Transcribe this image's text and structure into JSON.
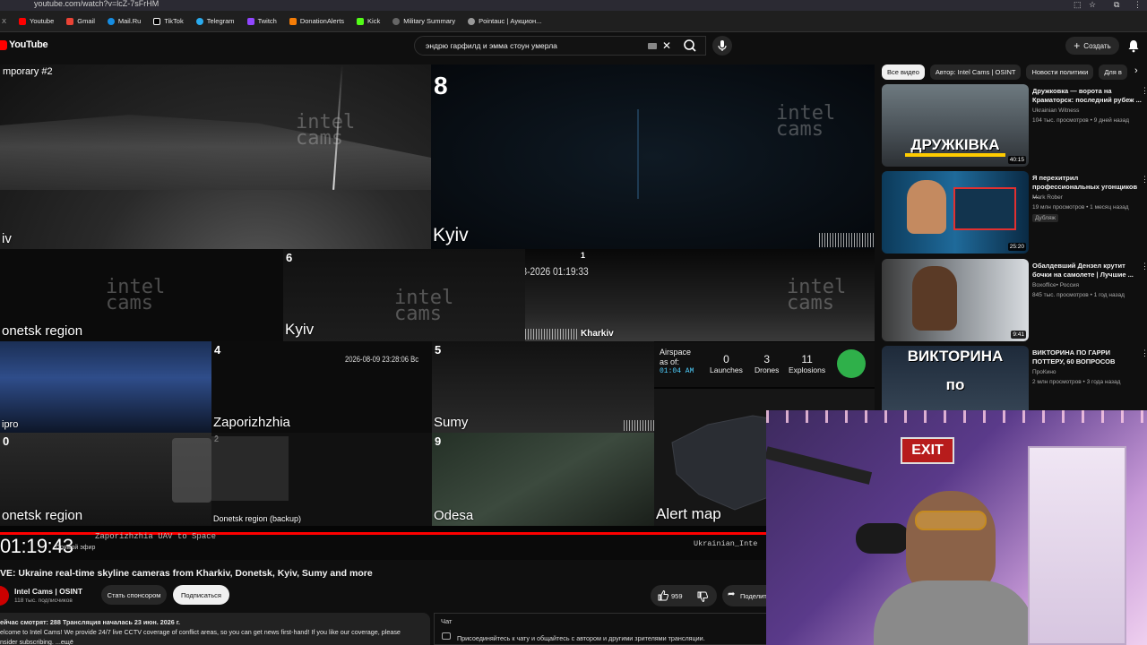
{
  "browser": {
    "url": "youtube.com/watch?v=lcZ-7sFrHM",
    "bookmarks": [
      "Youtube",
      "Gmail",
      "Mail.Ru",
      "TikTok",
      "Telegram",
      "Twitch",
      "DonationAlerts",
      "Kick",
      "Military Summary",
      "Pointauc | Аукцион..."
    ],
    "bookmark_colors": [
      "#ff0000",
      "#ea4335",
      "#168de2",
      "#ffffff",
      "#2aabee",
      "#9146ff",
      "#f57d07",
      "#53fc18",
      "#888888",
      "#dddddd"
    ]
  },
  "header": {
    "logo_text": "YouTube",
    "search_value": "эндрю гарфилд и эмма стоун умерла",
    "create_label": "Создать"
  },
  "video": {
    "tiles": {
      "t1": "mporary #2",
      "t1b": "iv",
      "t2_num": "8",
      "t2": "Kyiv",
      "t3": "onetsk region",
      "t4_num": "6",
      "t4": "Kyiv",
      "t5_num": "1",
      "t5_ts": "10-08-2026 01:19:33",
      "t5": "Kharkiv",
      "t6": "ipro",
      "t7_num": "4",
      "t7_ts": "2026-08-09 23:28:06 Вс",
      "t7": "Zaporizhzhia",
      "t8_num": "5",
      "t8": "Sumy",
      "t9_num": "0",
      "t9": "onetsk region",
      "t10_num": "2",
      "t10": "Donetsk region (backup)",
      "t11_num": "9",
      "t11": "Odesa",
      "t12": "Alert map"
    },
    "watermark_line1": "intel",
    "watermark_line2": "cams",
    "airspace": {
      "label": "Airspace",
      "label2": "as of:",
      "time": "01:04 AM",
      "launches_value": "0",
      "launches_label": "Launches",
      "drones_value": "3",
      "drones_label": "Drones",
      "explosions_value": "11",
      "explosions_label": "Explosions"
    },
    "elapsed": "01:19:43",
    "live_label": "Прямой эфир",
    "ticker": "Zaporizhzhia UAV to Space",
    "channel_overlay": "Ukrainian_Inte"
  },
  "info": {
    "title": "VE: Ukraine real-time skyline cameras from Kharkiv, Donetsk, Kyiv, Sumy and more",
    "channel": "Intel Cams | OSINT",
    "subscribers": "118 тыс. подписчиков",
    "sponsor_label": "Стать спонсором",
    "subscribe_label": "Подписаться",
    "likes": "959",
    "share_label": "Поделит",
    "desc_line1": "ейчас смотрят: 288  Трансляция началась 23 июн. 2026 г.",
    "desc_line2": "elcome to Intel Cams! We provide 24/7 live CCTV coverage of conflict areas, so you can get news first-hand! If you like our coverage, please",
    "desc_line3": "nsider subscribing. ...ещё"
  },
  "chat": {
    "header": "Чат",
    "message": "Присоединяйтесь к чату и общайтесь с автором и другими зрителями трансляции."
  },
  "sidebar": {
    "chips": [
      "Все видео",
      "Автор: Intel Cams | OSINT",
      "Новости политики",
      "Для в"
    ],
    "recs": [
      {
        "title": "Дружковка — ворота на Краматорск: последний рубеж ...",
        "channel": "Ukrainian Witness",
        "meta": "104 тыс. просмотров • 9 дней назад",
        "duration": "40:15",
        "thumb_text": "ДРУЖКІВКА"
      },
      {
        "title": "Я перехитрил профессиональных угонщиков ...",
        "channel": "Mark Rober",
        "meta": "19 млн просмотров • 1 месяц назад",
        "duration": "25:20",
        "badge": "Дубляж"
      },
      {
        "title": "Обалдевший Дензел крутит бочки на самолете | Лучшие ...",
        "channel": "Boxoffice• Россия",
        "meta": "845 тыс. просмотров • 1 год назад",
        "duration": "9:41"
      },
      {
        "title": "ВИКТОРИНА ПО ГАРРИ ПОТТЕРУ, 60 ВОПРОСОВ",
        "channel": "ПроКино",
        "meta": "2 млн просмотров • 3 года назад",
        "thumb_text": "ВИКТОРИНА",
        "thumb_text2": "по"
      }
    ]
  },
  "webcam": {
    "exit_sign": "EXIT"
  }
}
